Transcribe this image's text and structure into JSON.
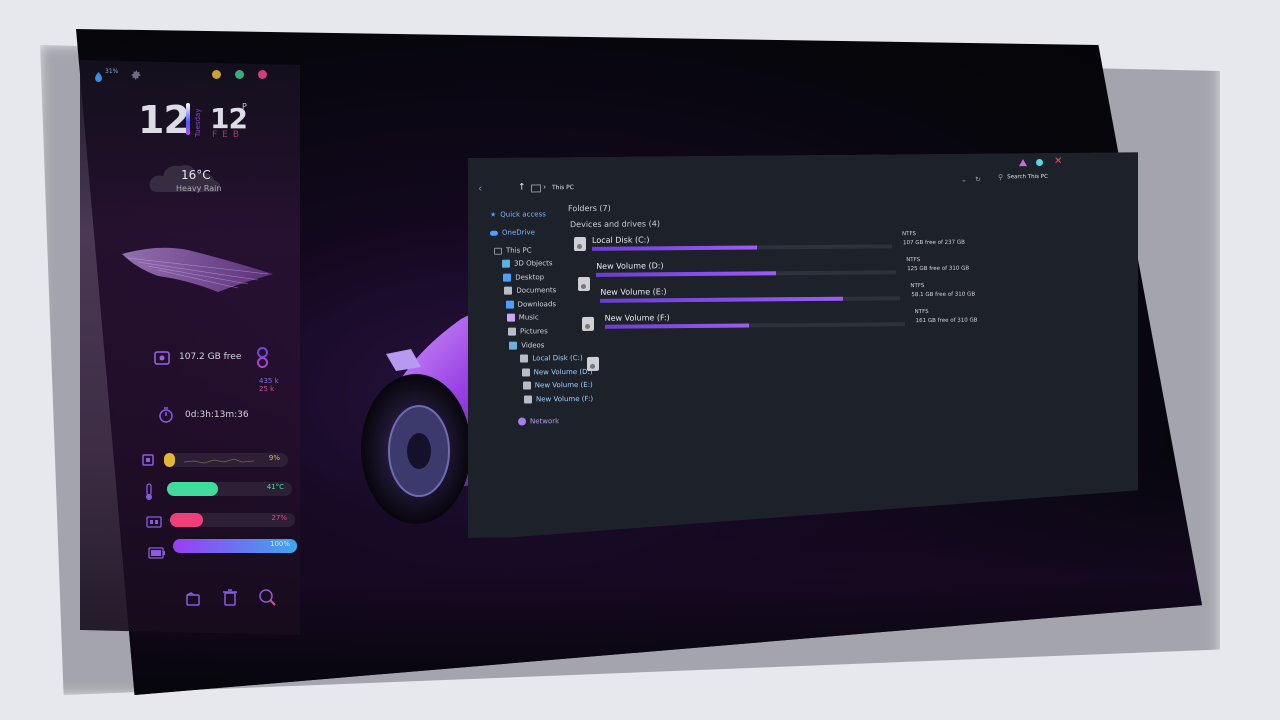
{
  "widgets": {
    "top_percent": "31%",
    "clock": {
      "hours": "12",
      "minutes": "12",
      "ampm": "P",
      "day": "Tuesday",
      "month": "FEB"
    },
    "weather": {
      "temp": "16°C",
      "condition": "Heavy Rain"
    },
    "disk": {
      "free": "107.2 GB free",
      "net_up": "435 k",
      "net_down": "25 k"
    },
    "uptime": "0d:3h:13m:36",
    "cpu": {
      "label": "9%",
      "value": 9
    },
    "temp": {
      "label": "41°C",
      "value": 41
    },
    "ram": {
      "label": "27%",
      "value": 27
    },
    "battery": {
      "label": "100%",
      "value": 100
    },
    "colors": {
      "cpu": "#e3b733",
      "temp": "#3fdc9c",
      "ram": "#ee3f7a",
      "battery_start": "#9a3df0",
      "battery_end": "#3ea7f0",
      "dot_yellow": "#c6a33a",
      "dot_green": "#35b07c",
      "dot_pink": "#d13d7a"
    },
    "icons": [
      "water-drop-icon",
      "gear-icon",
      "hard-drive-icon",
      "stopwatch-icon",
      "cpu-icon",
      "thermometer-icon",
      "ram-icon",
      "battery-icon",
      "folder-icon",
      "trash-icon",
      "search-icon"
    ]
  },
  "explorer": {
    "breadcrumb": "This PC",
    "search_placeholder": "Search This PC",
    "sections": {
      "folders": "Folders (7)",
      "devices": "Devices and drives (4)"
    },
    "nav": {
      "quick_access": "Quick access",
      "onedrive": "OneDrive",
      "this_pc": "This PC",
      "items": [
        "3D Objects",
        "Desktop",
        "Documents",
        "Downloads",
        "Music",
        "Pictures",
        "Videos",
        "Local Disk (C:)",
        "New Volume (D:)",
        "New Volume (E:)",
        "New Volume (F:)"
      ],
      "network": "Network"
    },
    "drives": [
      {
        "name": "Local Disk (C:)",
        "fs": "NTFS",
        "free": "107 GB free of 237 GB",
        "used_fraction": 0.55
      },
      {
        "name": "New Volume (D:)",
        "fs": "NTFS",
        "free": "125 GB free of 310 GB",
        "used_fraction": 0.6
      },
      {
        "name": "New Volume (E:)",
        "fs": "NTFS",
        "free": "58.1 GB free of 310 GB",
        "used_fraction": 0.81
      },
      {
        "name": "New Volume (F:)",
        "fs": "NTFS",
        "free": "161 GB free of 310 GB",
        "used_fraction": 0.48
      }
    ],
    "window_controls": {
      "minimize_color": "#c86be0",
      "maximize_color": "#5bd6e6",
      "close_color": "#ef4b6a"
    }
  }
}
